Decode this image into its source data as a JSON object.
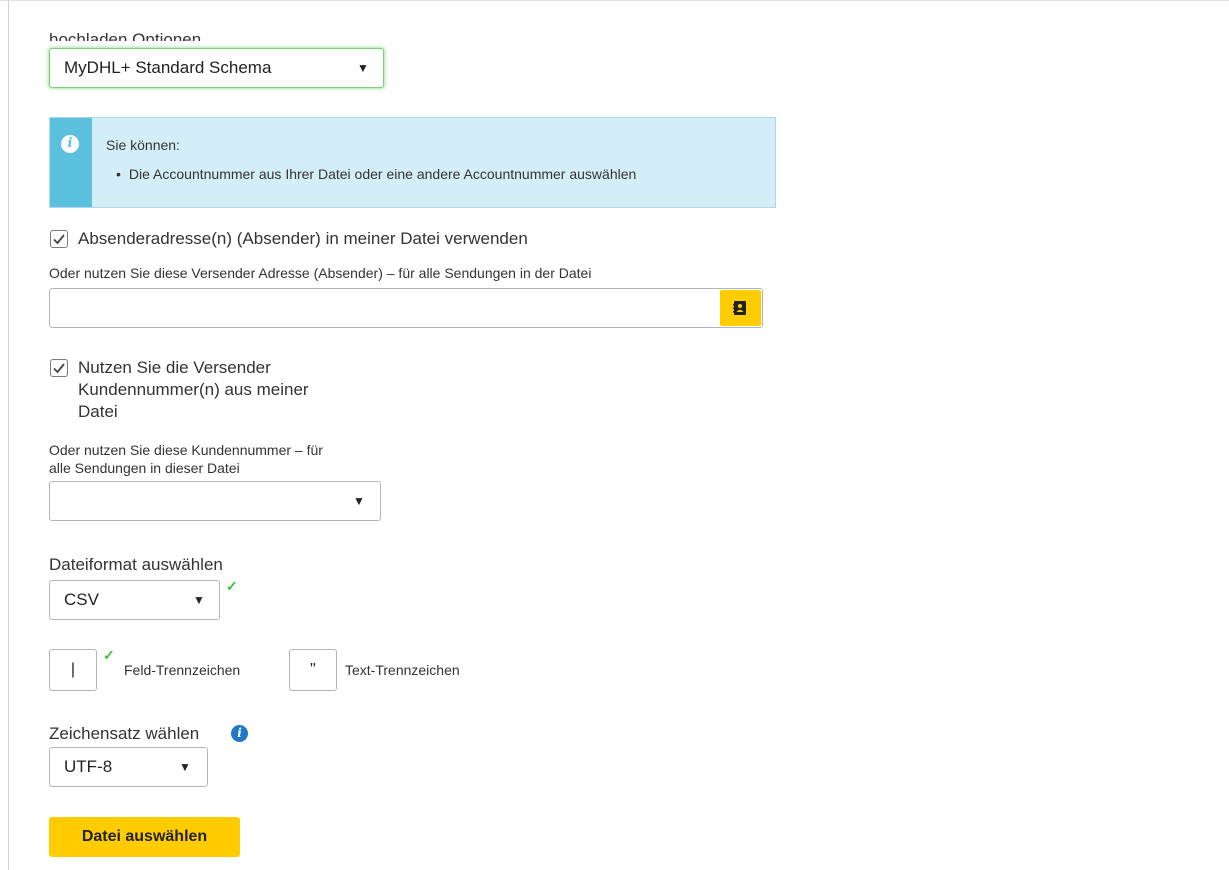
{
  "upload_options": {
    "label": "hochladen Optionen",
    "schema_select": {
      "value": "MyDHL+ Standard Schema"
    }
  },
  "info_box": {
    "title": "Sie können:",
    "bullets": [
      "Die Accountnummer aus Ihrer Datei oder eine andere Accountnummer auswählen"
    ]
  },
  "shipper_address": {
    "checkbox_label": "Absenderadresse(n) (Absender) in meiner Datei verwenden",
    "checked": true,
    "alt_label": "Oder nutzen Sie diese  Versender Adresse (Absender) – für alle Sendungen in der Datei",
    "input_value": "",
    "address_book_icon": "address-book-icon"
  },
  "customer_number": {
    "checkbox_label_lines": [
      "Nutzen Sie die Versender",
      "Kundennummer(n) aus meiner",
      "Datei"
    ],
    "checked": true,
    "alt_label_lines": [
      "Oder nutzen Sie diese Kundennummer – für",
      "alle Sendungen in dieser Datei"
    ],
    "select_value": ""
  },
  "file_format": {
    "label": "Dateiformat auswählen",
    "value": "CSV",
    "valid": true
  },
  "separators": {
    "field_value": "|",
    "field_label": "Feld-Trennzeichen",
    "field_valid": true,
    "text_value": "\"",
    "text_label": "Text-Trennzeichen"
  },
  "charset": {
    "label": "Zeichensatz wählen",
    "value": "UTF-8"
  },
  "actions": {
    "choose_file_label": "Datei auswählen"
  },
  "colors": {
    "accent_yellow": "#ffcc00",
    "info_bg": "#d4eef8",
    "info_bar": "#5bc0de",
    "valid_green": "#3fbf3f",
    "info_blue": "#1f78c8"
  }
}
